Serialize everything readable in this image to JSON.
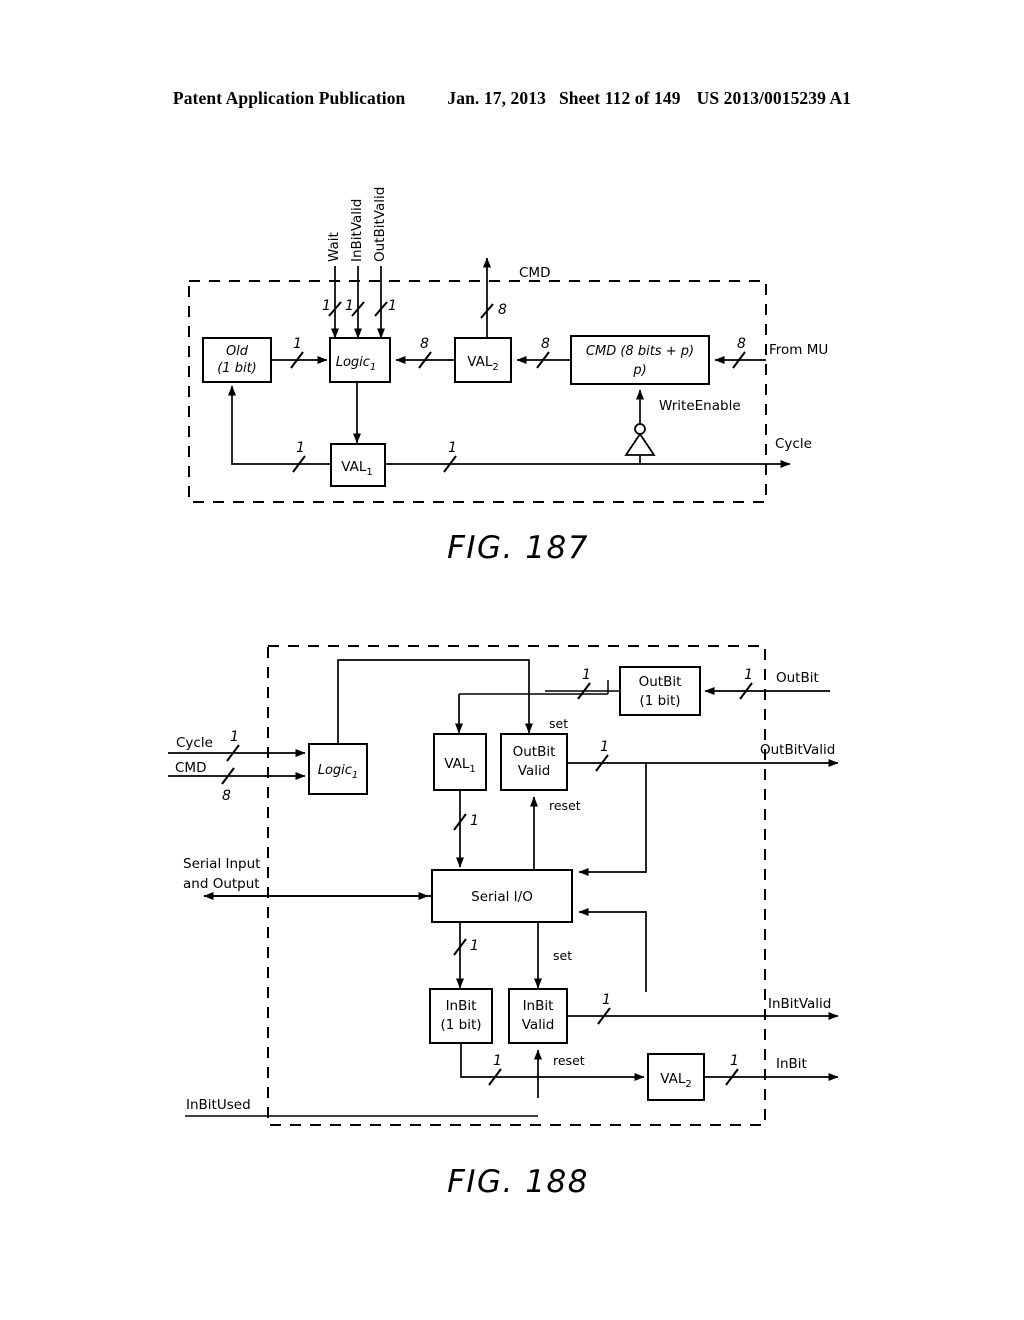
{
  "header": {
    "publication": "Patent Application Publication",
    "date": "Jan. 17, 2013",
    "sheet": "Sheet 112 of 149",
    "patent_number": "US 2013/0015239 A1"
  },
  "figures": [
    {
      "caption": "FIG. 187",
      "boxes": [
        {
          "id": "old",
          "line1": "Old",
          "line2": "(1 bit)"
        },
        {
          "id": "logic1",
          "line1": "Logic",
          "sub": "1"
        },
        {
          "id": "val2",
          "line1": "VAL",
          "sub": "2"
        },
        {
          "id": "cmd_reg",
          "line1": "CMD (8 bits + p)",
          "line2": "p)"
        },
        {
          "id": "val1",
          "line1": "VAL",
          "sub": "1"
        }
      ],
      "signals": [
        {
          "id": "wait",
          "label": "Wait",
          "width": "1"
        },
        {
          "id": "inbitvalid",
          "label": "InBitValid",
          "width": "1"
        },
        {
          "id": "outbitvalid",
          "label": "OutBitValid",
          "width": "1"
        },
        {
          "id": "cmd_out",
          "label": "CMD",
          "width": "8"
        },
        {
          "id": "from_mu",
          "label": "From MU",
          "width": "8"
        },
        {
          "id": "writeenable",
          "label": "WriteEnable"
        },
        {
          "id": "cycle_out",
          "label": "Cycle"
        }
      ],
      "bit_widths": [
        "1",
        "1",
        "1",
        "1",
        "8",
        "8",
        "8",
        "8",
        "1",
        "1"
      ]
    },
    {
      "caption": "FIG. 188",
      "boxes": [
        {
          "id": "logic1",
          "line1": "Logic",
          "sub": "1"
        },
        {
          "id": "val1",
          "line1": "VAL",
          "sub": "1"
        },
        {
          "id": "outbitvalid_box",
          "line1": "OutBit",
          "line2": "Valid"
        },
        {
          "id": "outbit_box",
          "line1": "OutBit",
          "line2": "(1 bit)"
        },
        {
          "id": "serialio",
          "line1": "Serial I/O"
        },
        {
          "id": "inbit_box",
          "line1": "InBit",
          "line2": "(1 bit)"
        },
        {
          "id": "inbitvalid_box",
          "line1": "InBit",
          "line2": "Valid"
        },
        {
          "id": "val2",
          "line1": "VAL",
          "sub": "2"
        }
      ],
      "signals": [
        {
          "id": "cycle_in",
          "label": "Cycle",
          "width": "1"
        },
        {
          "id": "cmd_in",
          "label": "CMD",
          "width": "8"
        },
        {
          "id": "outbit_in",
          "label": "OutBit",
          "width": "1"
        },
        {
          "id": "outbitvalid_out",
          "label": "OutBitValid",
          "width": "1"
        },
        {
          "id": "serial_io_port",
          "label_line1": "Serial Input",
          "label_line2": "and Output"
        },
        {
          "id": "inbitvalid_out",
          "label": "InBitValid",
          "width": "1"
        },
        {
          "id": "inbit_out",
          "label": "InBit",
          "width": "1"
        },
        {
          "id": "inbitused_in",
          "label": "InBitUsed"
        }
      ],
      "annotations": [
        {
          "id": "set_outbit",
          "label": "set"
        },
        {
          "id": "reset_outbit",
          "label": "reset"
        },
        {
          "id": "set_inbit",
          "label": "set"
        },
        {
          "id": "reset_inbit",
          "label": "reset"
        }
      ],
      "bit_widths": [
        "1",
        "8",
        "1",
        "1",
        "1",
        "1",
        "1",
        "1",
        "1",
        "1"
      ]
    }
  ],
  "colors": {
    "ink": "#000000",
    "paper": "#ffffff"
  }
}
